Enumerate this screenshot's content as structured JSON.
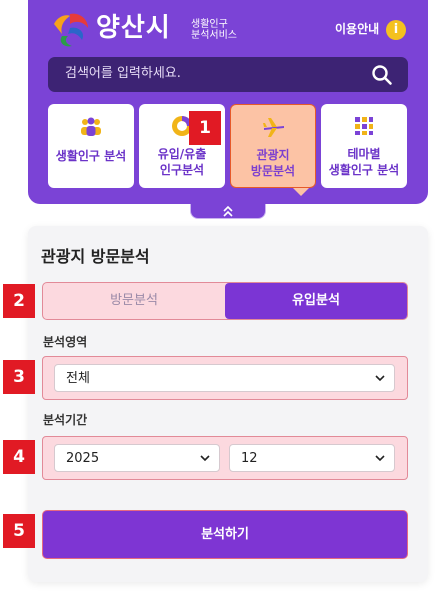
{
  "header": {
    "brand": "양산시",
    "brand_sub_1": "생활인구",
    "brand_sub_2": "분석서비스",
    "guide_label": "이용안내",
    "guide_icon": "i",
    "accent_color": "#7b43d6"
  },
  "search": {
    "placeholder": "검색어를 입력하세요."
  },
  "tiles": [
    {
      "icon": "people-icon",
      "line1": "생활인구 분석",
      "line2": ""
    },
    {
      "icon": "chart-icon",
      "line1": "유입/유출",
      "line2": "인구분석"
    },
    {
      "icon": "airplane-icon",
      "line1": "관광지",
      "line2": "방문분석",
      "active": true
    },
    {
      "icon": "grid-icon",
      "line1": "테마별",
      "line2": "생활인구 분석"
    }
  ],
  "panel": {
    "title": "관광지 방문분석",
    "segments": {
      "left": "방문분석",
      "right": "유입분석",
      "selected": "유입분석"
    },
    "area_label": "분석영역",
    "area_value": "전체",
    "period_label": "분석기간",
    "year_value": "2025",
    "month_value": "12",
    "submit_label": "분석하기"
  },
  "markers": [
    "1",
    "2",
    "3",
    "4",
    "5"
  ]
}
